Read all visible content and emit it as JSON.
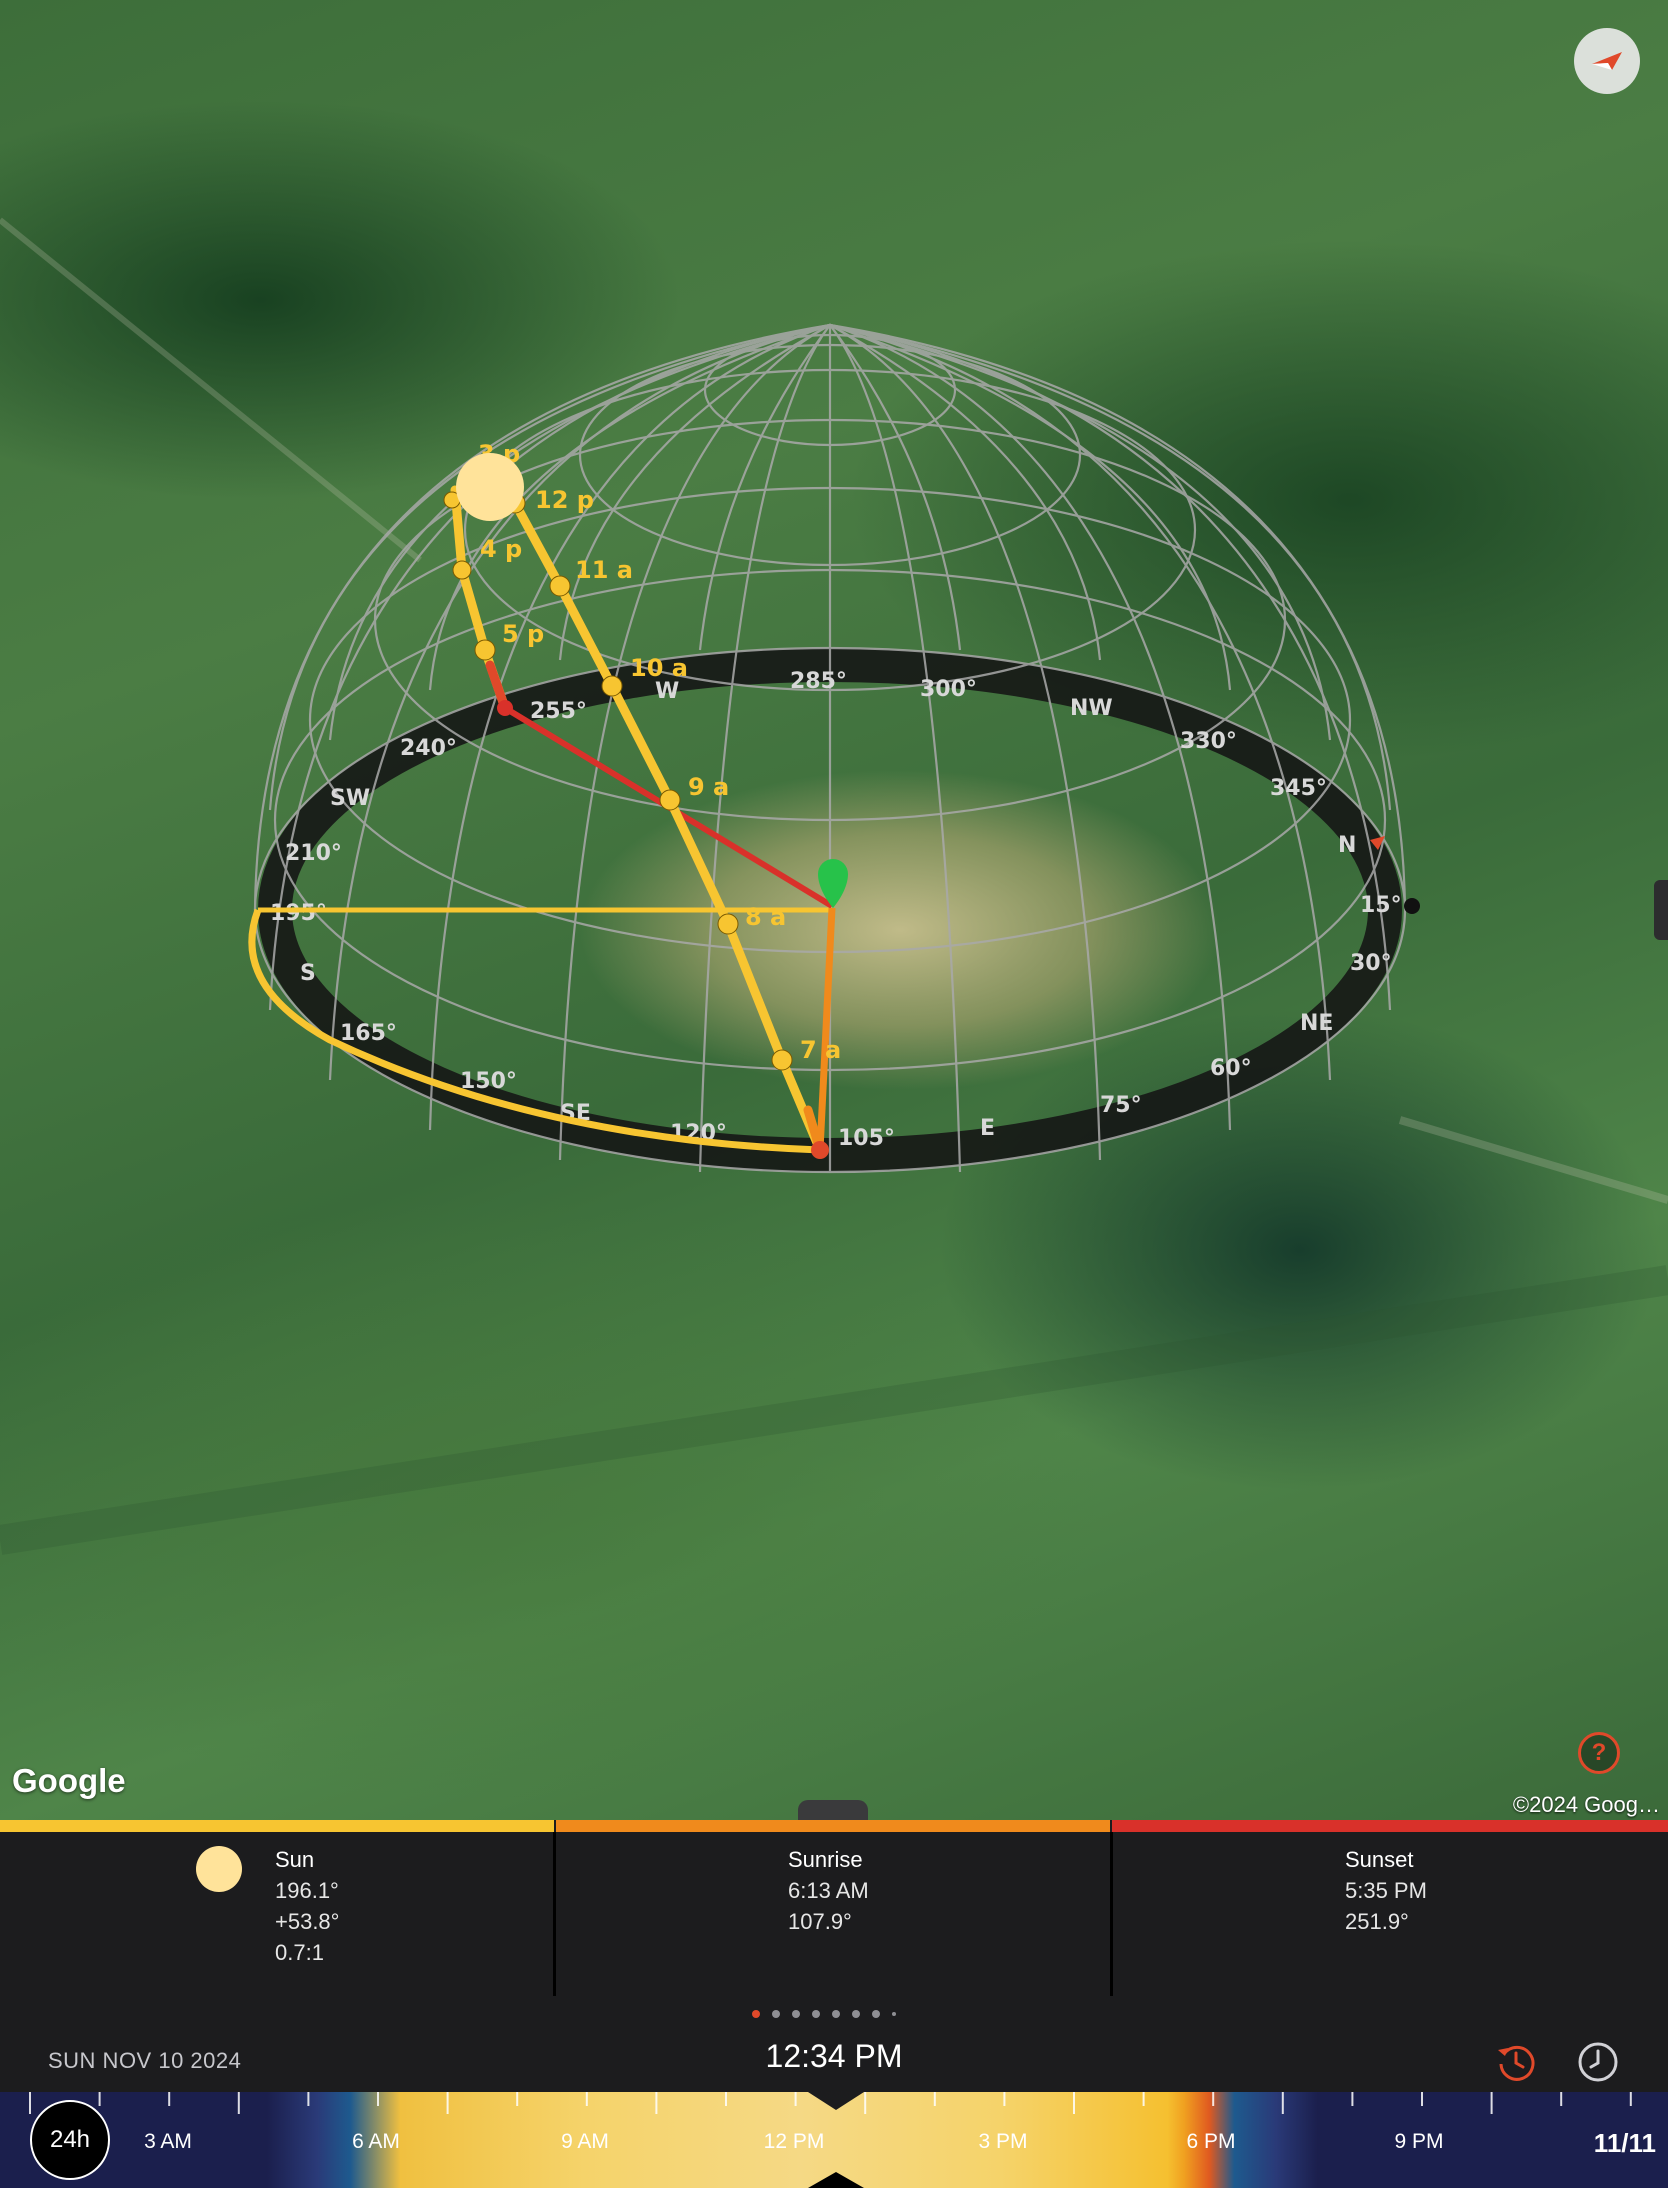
{
  "map": {
    "provider_logo": "Google",
    "copyright": "©2024 Goog…",
    "compass_icon": "compass-arrow-icon",
    "help_label": "?",
    "hour_markers": [
      "7 a",
      "8 a",
      "9 a",
      "10 a",
      "11 a",
      "12 p",
      "3 p",
      "4 p",
      "5 p"
    ],
    "compass_ring_labels": [
      "285°",
      "300°",
      "NW",
      "330°",
      "345°",
      "N",
      "15°",
      "30°",
      "NE",
      "60°",
      "75°",
      "E",
      "105°",
      "120°",
      "SE",
      "150°",
      "165°",
      "S",
      "195°",
      "210°",
      "SW",
      "240°",
      "W",
      "255°"
    ],
    "colors": {
      "sun_path": "#f7c531",
      "sunrise_line": "#f08a1c",
      "sunset_line": "#d9312a",
      "location_pin": "#27c24a",
      "sun_disc": "#ffe39a"
    }
  },
  "info": {
    "sun": {
      "title": "Sun",
      "azimuth": "196.1°",
      "elevation": "+53.8°",
      "shadow_ratio": "0.7:1",
      "bar_color": "#f7c531"
    },
    "sunrise": {
      "title": "Sunrise",
      "time": "6:13 AM",
      "azimuth": "107.9°",
      "bar_color": "#f08a1c"
    },
    "sunset": {
      "title": "Sunset",
      "time": "5:35 PM",
      "azimuth": "251.9°",
      "bar_color": "#d9312a"
    }
  },
  "datetime": {
    "date": "SUN NOV 10 2024",
    "time": "12:34 PM"
  },
  "timeline": {
    "mode_button": "24h",
    "hour_labels": [
      "3 AM",
      "6 AM",
      "9 AM",
      "12 PM",
      "3 PM",
      "6 PM",
      "9 PM"
    ],
    "end_date": "11/11"
  }
}
